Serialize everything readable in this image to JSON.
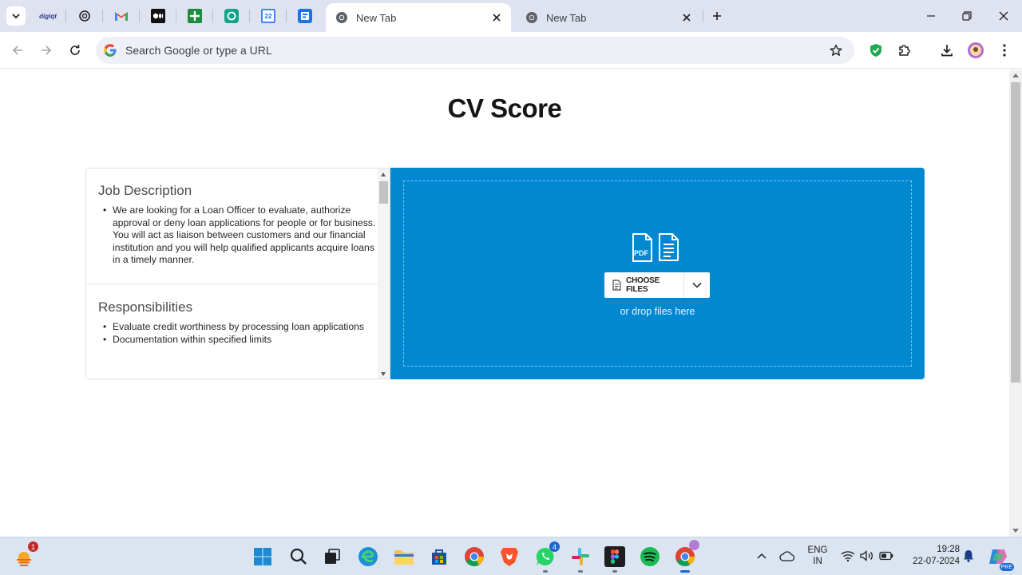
{
  "browser": {
    "pinned_tabs": [
      {
        "name": "digiq-tab",
        "icon": "digiq-icon",
        "label": "digiqt"
      },
      {
        "name": "openai-tab",
        "icon": "openai-icon"
      },
      {
        "name": "gmail-tab",
        "icon": "gmail-icon"
      },
      {
        "name": "medium-tab",
        "icon": "medium-icon"
      },
      {
        "name": "sheets-tab",
        "icon": "google-sheets-icon"
      },
      {
        "name": "app-tab",
        "icon": "teal-app-icon"
      },
      {
        "name": "calendar-tab",
        "icon": "calendar-icon",
        "label": "22"
      },
      {
        "name": "forms-tab",
        "icon": "forms-icon"
      }
    ],
    "tabs": [
      {
        "title": "New Tab",
        "active": true
      },
      {
        "title": "New Tab",
        "active": false
      }
    ],
    "omnibox": {
      "placeholder": "Search Google or type a URL"
    }
  },
  "page": {
    "title": "CV Score",
    "job_description": {
      "heading": "Job Description",
      "items": [
        "We are looking for a Loan Officer to evaluate, authorize approval or deny loan applications for people or for business. You will act as liaison between customers and our financial institution and you will help qualified applicants acquire loans in a timely manner."
      ]
    },
    "responsibilities": {
      "heading": "Responsibilities",
      "items": [
        "Evaluate credit worthiness by processing loan applications",
        "Documentation within specified limits"
      ]
    },
    "upload": {
      "choose_label": "CHOOSE FILES",
      "drop_text": "or drop files here",
      "pdf_label": "PDF"
    }
  },
  "taskbar": {
    "notification_badge": "1",
    "whatsapp_badge": "4",
    "language": {
      "line1": "ENG",
      "line2": "IN"
    },
    "time": "19:28",
    "date": "22-07-2024",
    "copilot_label": "PRE"
  },
  "colors": {
    "accent": "#0288d1",
    "tabstrip": "#dfe3f0",
    "taskbar": "#dbe5f1"
  }
}
